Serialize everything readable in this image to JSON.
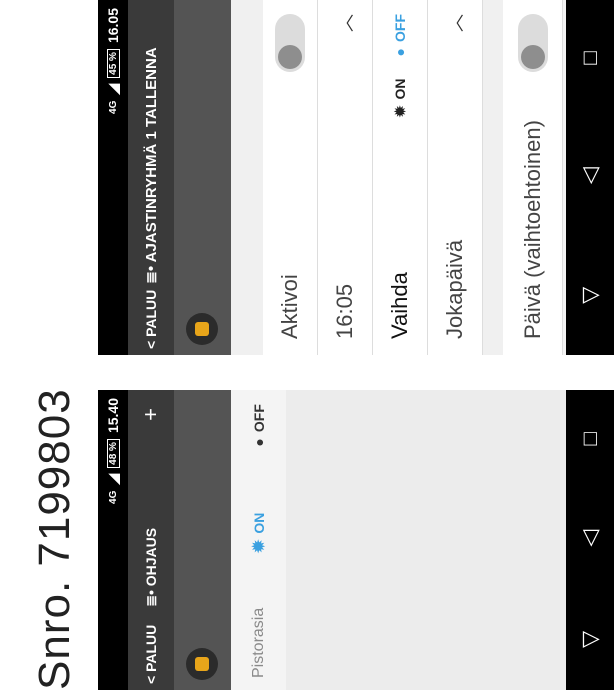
{
  "caption": "Snro. 7199803",
  "screen1": {
    "status": {
      "network": "4G",
      "battery": "48 %",
      "time": "15.40"
    },
    "topbar": {
      "back": "< PALUU",
      "title": "≣• OHJAUS",
      "plus": "+"
    },
    "row": {
      "name": "Pistorasia",
      "on": "ON",
      "off": "OFF"
    },
    "nav": {
      "back": "▽",
      "home": "◁",
      "recents": "□"
    }
  },
  "screen2": {
    "status": {
      "network": "4G",
      "battery": "45 %",
      "time": "16.05"
    },
    "topbar": {
      "back": "< PALUU",
      "title": "≣• AJASTINRYHMÄ 1 TALLENNA"
    },
    "rows": {
      "active": "Aktivoi",
      "time": "16:05",
      "switch": "Vaihda",
      "on": "ON",
      "off": "OFF",
      "repeat": "Jokapäivä",
      "date": "Päivä (vaihtoehtoinen)"
    },
    "nav": {
      "back": "▽",
      "home": "◁",
      "recents": "□"
    }
  }
}
